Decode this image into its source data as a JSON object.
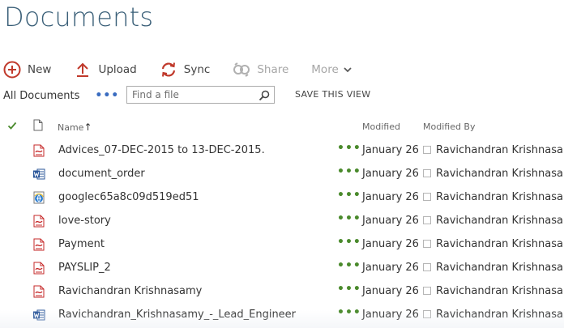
{
  "page": {
    "title": "Documents"
  },
  "commands": {
    "new_label": "New",
    "upload_label": "Upload",
    "sync_label": "Sync",
    "share_label": "Share",
    "more_label": "More"
  },
  "view": {
    "name": "All Documents",
    "ellipsis": "•••",
    "search_placeholder": "Find a file",
    "save_label": "SAVE THIS VIEW"
  },
  "columns": {
    "name": "Name",
    "name_sort": "↑",
    "modified": "Modified",
    "modified_by": "Modified By"
  },
  "files": [
    {
      "name": "Advices_07-DEC-2015 to 13-DEC-2015.",
      "icon": "pdf-icon",
      "modified": "January 26",
      "modified_by": "Ravichandran Krishnasamy"
    },
    {
      "name": "document_order",
      "icon": "word-icon",
      "modified": "January 26",
      "modified_by": "Ravichandran Krishnasamy"
    },
    {
      "name": "googlec65a8c09d519ed51",
      "icon": "html-icon",
      "modified": "January 26",
      "modified_by": "Ravichandran Krishnasamy"
    },
    {
      "name": "love-story",
      "icon": "pdf-icon",
      "modified": "January 26",
      "modified_by": "Ravichandran Krishnasamy"
    },
    {
      "name": "Payment",
      "icon": "pdf-icon",
      "modified": "January 26",
      "modified_by": "Ravichandran Krishnasamy"
    },
    {
      "name": "PAYSLIP_2",
      "icon": "pdf-icon",
      "modified": "January 26",
      "modified_by": "Ravichandran Krishnasamy"
    },
    {
      "name": "Ravichandran Krishnasamy",
      "icon": "pdf-icon",
      "modified": "January 26",
      "modified_by": "Ravichandran Krishnasamy"
    },
    {
      "name": "Ravichandran_Krishnasamy_-_Lead_Engineer",
      "icon": "word-icon",
      "modified": "January 26",
      "modified_by": "Ravichandran Krishnasamy"
    }
  ],
  "row_ellipsis": "•••",
  "colors": {
    "title": "#3a5f78",
    "new_icon": "#c0392b",
    "upload_icon": "#c0392b",
    "sync_icon": "#c0392b",
    "disabled": "#a6a6a6",
    "row_ellipsis": "#4a8a2c",
    "pdf": "#c62828",
    "word": "#2b579a"
  }
}
